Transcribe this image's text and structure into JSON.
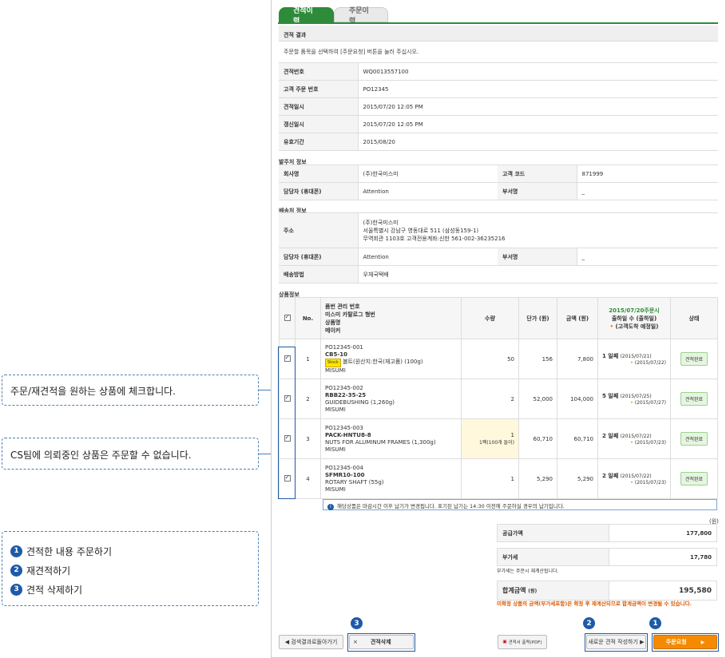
{
  "callouts": {
    "check": "주문/재견적을 원하는 상품에 체크합니다.",
    "cs": "CS팀에 의뢰중인 상품은 주문할 수 없습니다.",
    "steps": [
      {
        "num": "1",
        "text": "견적한 내용 주문하기"
      },
      {
        "num": "2",
        "text": "재견적하기"
      },
      {
        "num": "3",
        "text": "견적 삭제하기"
      }
    ]
  },
  "tabs": {
    "active": "견적이력",
    "inactive": "주문이력"
  },
  "result": {
    "title": "견적 결과",
    "desc": "주문할 품목을 선택하여 [주문요청] 버튼을 눌러 주십시오.",
    "rows": [
      {
        "label": "견적번호",
        "value": "WQ0013557100"
      },
      {
        "label": "고객 주문 번호",
        "value": "PO12345"
      },
      {
        "label": "견적일시",
        "value": "2015/07/20 12:05 PM"
      },
      {
        "label": "갱신일시",
        "value": "2015/07/20 12:05 PM"
      },
      {
        "label": "유효기간",
        "value": "2015/08/20"
      }
    ]
  },
  "orderer": {
    "title": "발주처 정보",
    "company_label": "회사명",
    "company": "(주)한국미스미",
    "code_label": "고객 코드",
    "code": "871999",
    "contact_label": "담당자 (휴대폰)",
    "contact": "Attention",
    "dept_label": "부서명",
    "dept": "_"
  },
  "shipping": {
    "title": "배송처 정보",
    "addr_label": "주소",
    "addr1": "(주)한국미스미",
    "addr2": "서울특별시 강남구 영동대로 511 (삼성동159-1)",
    "addr3": "무역회관 1103호 고객전용계좌:신한 561-002-36235216",
    "contact_label": "담당자 (휴대폰)",
    "contact": "Attention",
    "dept_label": "부서명",
    "dept": "_",
    "method_label": "배송방법",
    "method": "우체국택배"
  },
  "items": {
    "title": "상품정보",
    "headers": {
      "no": "No.",
      "part1": "품번 관리 번호",
      "part2": "미스미 카탈로그 형번",
      "part3": "상품명",
      "part4": "메이커",
      "qty": "수량",
      "unit": "단가 (원)",
      "amount": "금액 (원)",
      "ship1": "2015/07/20주문시",
      "ship2": "출하일 수 (출하일)",
      "ship3": "(고객도착 예정일)",
      "status": "상태"
    },
    "rows": [
      {
        "no": "1",
        "mgmt": "PO12345-001",
        "code": "CB5-10",
        "stock": "Stock",
        "name": "볼트(원산지:한국(재고품) (100g)",
        "maker": "MISUMI",
        "qty": "50",
        "qty_note": "",
        "unit": "156",
        "amount": "7,800",
        "days": "1 일째",
        "ship": "(2015/07/21)",
        "arrive": "(2015/07/22)",
        "status": "견적완료"
      },
      {
        "no": "2",
        "mgmt": "PO12345-002",
        "code": "RBB22-35-25",
        "stock": "",
        "name": "GUIDEBUSHING (1,260g)",
        "maker": "MISUMI",
        "qty": "2",
        "qty_note": "",
        "unit": "52,000",
        "amount": "104,000",
        "days": "5 일째",
        "ship": "(2015/07/25)",
        "arrive": "(2015/07/27)",
        "status": "견적완료"
      },
      {
        "no": "3",
        "mgmt": "PO12345-003",
        "code": "PACK-HNTU8-8",
        "stock": "",
        "name": "NUTS FOR ALUMINUM FRAMES (1,300g)",
        "maker": "MISUMI",
        "qty": "1",
        "qty_note": "1팩(100개 들이)",
        "unit": "60,710",
        "amount": "60,710",
        "days": "2 일째",
        "ship": "(2015/07/22)",
        "arrive": "(2015/07/23)",
        "status": "견적완료"
      },
      {
        "no": "4",
        "mgmt": "PO12345-004",
        "code": "SFMR10-100",
        "stock": "",
        "name": "ROTARY SHAFT (55g)",
        "maker": "MISUMI",
        "qty": "1",
        "qty_note": "",
        "unit": "5,290",
        "amount": "5,290",
        "days": "2 일째",
        "ship": "(2015/07/22)",
        "arrive": "(2015/07/23)",
        "status": "견적완료"
      }
    ],
    "note": "해당상품은 마감시간 이후 납기가 변경됩니다. 표기된 납기는 14:30 이전에 주문하실 경우의 납기입니다."
  },
  "totals": {
    "unit": "(원)",
    "supply_label": "공급가액",
    "supply": "177,800",
    "vat_label": "부가세",
    "vat": "17,780",
    "vat_note": "부가세는 주문시 재계산됩니다.",
    "total_label": "합계금액",
    "total_unit": "(원)",
    "total": "195,580",
    "warning": "미확정 상품의 금액(부가세포함)은 확정 후 재계산되므로 합계금액이 변경될 수 있습니다."
  },
  "buttons": {
    "back": "◀ 검색결과로돌아가기",
    "delete_x": "×",
    "delete": "견적삭제",
    "pdf": "견적서 출력(PDF)",
    "new": "새로운 견적 작성하기 ▶",
    "order": "주문요청",
    "order_arrow": "▶",
    "step1": "1",
    "step2": "2",
    "step3": "3"
  },
  "colors": {
    "brand_green": "#2e8b3a",
    "accent_orange": "#f58a00",
    "callout_blue": "#1e5aa8"
  }
}
